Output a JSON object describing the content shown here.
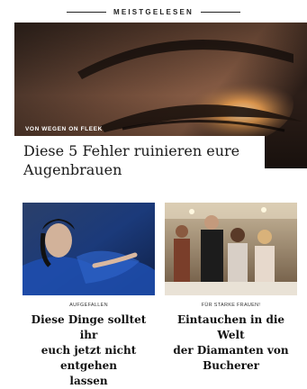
{
  "section": {
    "title": "MEISTGELESEN"
  },
  "hero": {
    "kicker": "VON WEGEN ON FLEEK",
    "title_line1": "Diese 5 Fehler ruinieren eure",
    "title_line2": "Augenbrauen"
  },
  "cards": [
    {
      "kicker": "AUFGEFALLEN",
      "title_line1": "Diese Dinge solltet ihr",
      "title_line2": "euch jetzt nicht entgehen",
      "title_line3": "lassen"
    },
    {
      "kicker": "FÜR STARKE FRAUEN!",
      "title_line1": "Eintauchen in die Welt",
      "title_line2": "der Diamanten von",
      "title_line3": "Bucherer"
    }
  ]
}
